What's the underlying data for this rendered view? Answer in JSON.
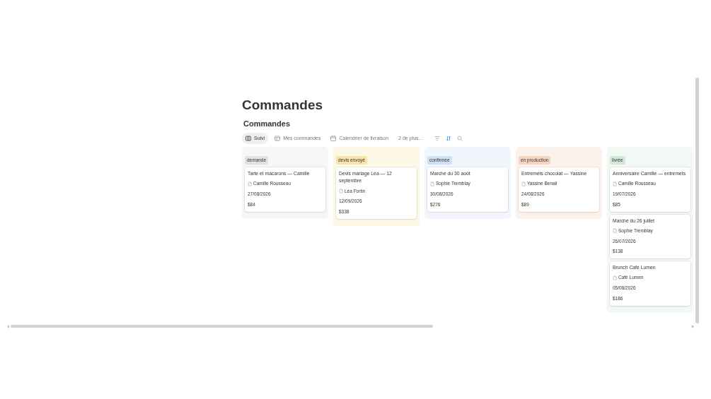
{
  "page": {
    "title": "Commandes"
  },
  "database": {
    "title": "Commandes"
  },
  "views": [
    {
      "label": "Suivi",
      "selected": true
    },
    {
      "label": "Mes commandes",
      "selected": false
    },
    {
      "label": "Calendrier de livraison",
      "selected": false
    }
  ],
  "more_views": "2 de plus…",
  "toolbar": [
    {
      "kind": "filter",
      "active": false
    },
    {
      "kind": "sort",
      "active": true
    },
    {
      "kind": "search",
      "active": false
    }
  ],
  "columns": [
    {
      "status": "demande",
      "color": "#e3e2e0",
      "cards": [
        {
          "title": "Tarte et macarons — Camille",
          "client": "Camille Rousseau",
          "date": "27/08/2026",
          "amount": "$84"
        }
      ]
    },
    {
      "status": "devis envoyé",
      "color": "#f8e3a8",
      "cards": [
        {
          "title": "Devis mariage Léa — 12 septembre",
          "client": "Léa Fortin",
          "date": "12/09/2026",
          "amount": "$338"
        }
      ]
    },
    {
      "status": "confirmée",
      "color": "#cde1f5",
      "cards": [
        {
          "title": "Marché du 30 août",
          "client": "Sophie Tremblay",
          "date": "30/08/2026",
          "amount": "$276"
        }
      ]
    },
    {
      "status": "en production",
      "color": "#f5d5c1",
      "cards": [
        {
          "title": "Entremets chocolat — Yassine",
          "client": "Yassine Benali",
          "date": "24/08/2026",
          "amount": "$89"
        }
      ]
    },
    {
      "status": "livrée",
      "color": "#d3e7da",
      "cards": [
        {
          "title": "Anniversaire Camille — entremets",
          "client": "Camille Rousseau",
          "date": "19/07/2026",
          "amount": "$85"
        },
        {
          "title": "Marché du 26 juillet",
          "client": "Sophie Tremblay",
          "date": "26/07/2026",
          "amount": "$138"
        },
        {
          "title": "Brunch Café Lumen",
          "client": "Café Lumen",
          "date": "05/08/2026",
          "amount": "$186"
        }
      ]
    }
  ]
}
